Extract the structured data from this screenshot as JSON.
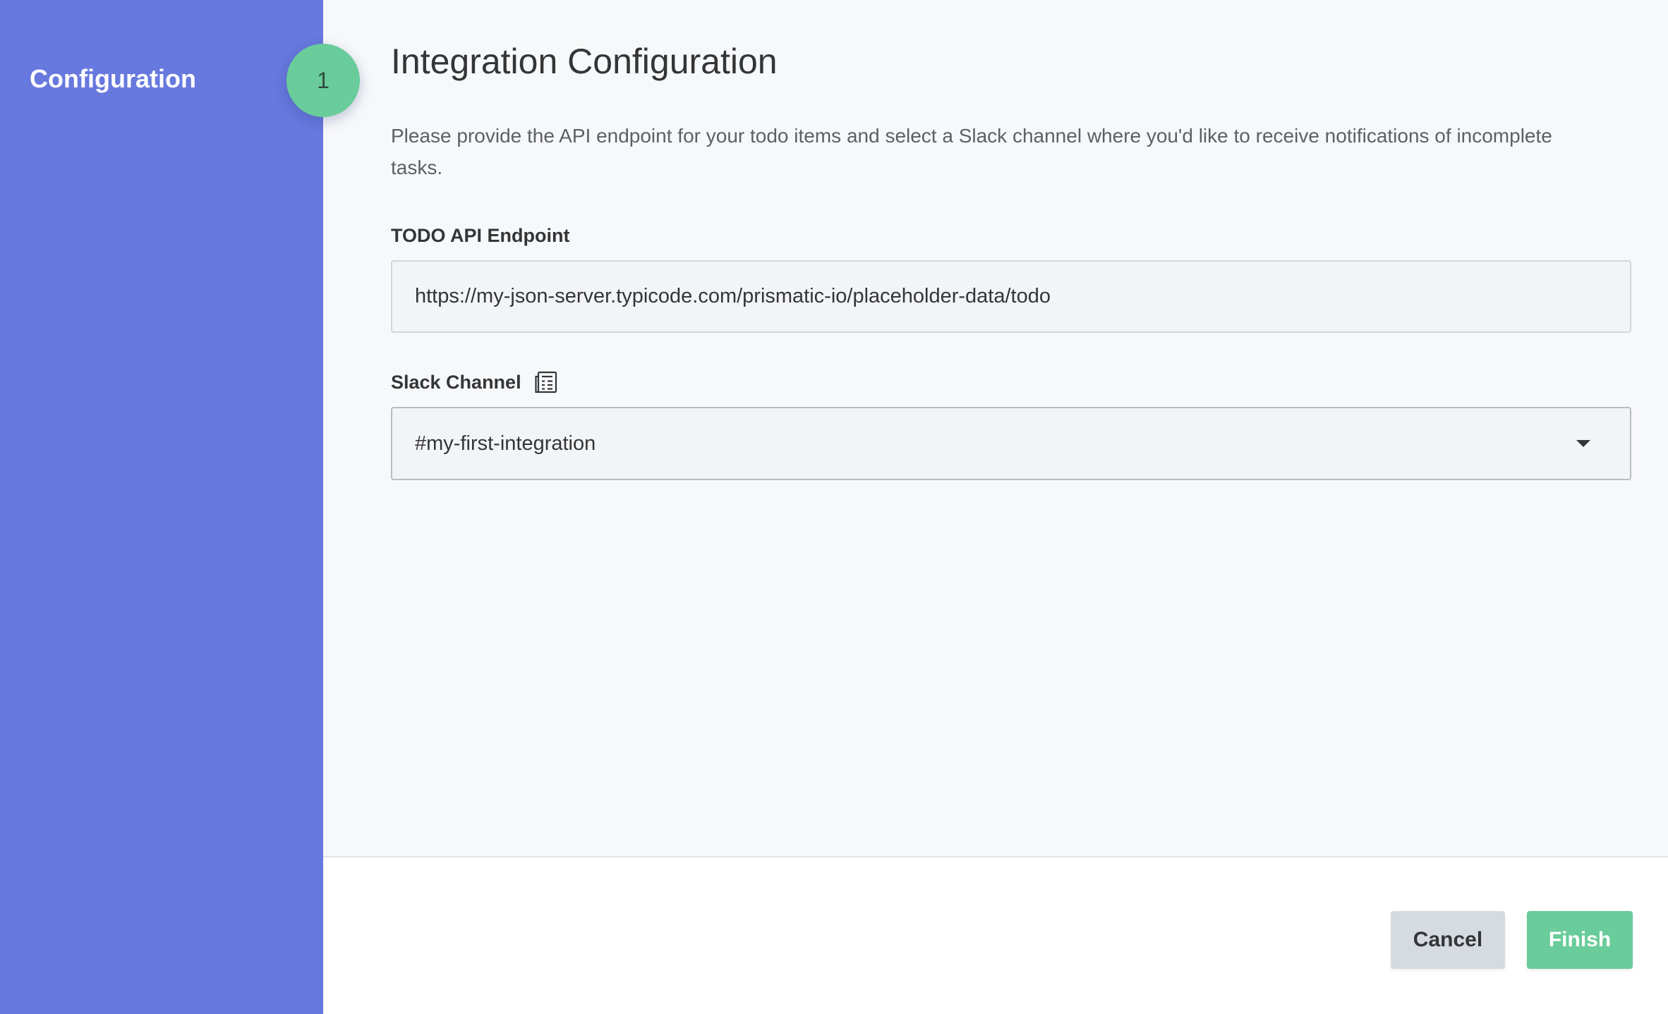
{
  "sidebar": {
    "title": "Configuration",
    "step_number": "1"
  },
  "main": {
    "title": "Integration Configuration",
    "description": "Please provide the API endpoint for your todo items and select a Slack channel where you'd like to receive notifications of incomplete tasks.",
    "endpoint": {
      "label": "TODO API Endpoint",
      "value": "https://my-json-server.typicode.com/prismatic-io/placeholder-data/todo"
    },
    "slack": {
      "label": "Slack Channel",
      "label_icon": "data-source-icon",
      "selected": "#my-first-integration",
      "dropdown_icon": "chevron-down-icon"
    }
  },
  "footer": {
    "cancel_label": "Cancel",
    "finish_label": "Finish"
  },
  "colors": {
    "sidebar": "#6778de",
    "accent": "#69cc9a",
    "cancel_bg": "#d5dbe1",
    "page_bg": "#f7f8fa"
  }
}
